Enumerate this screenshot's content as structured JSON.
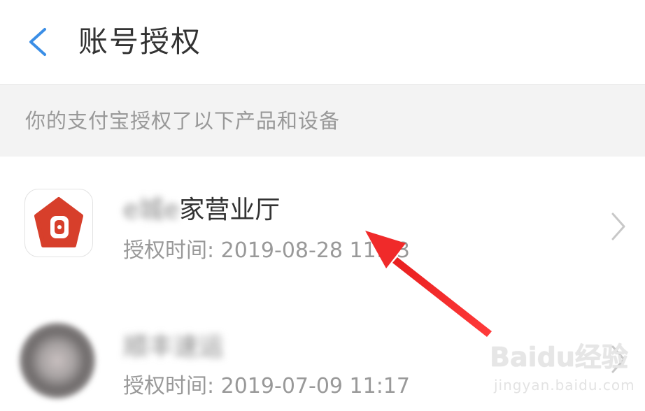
{
  "header": {
    "title": "账号授权",
    "back_icon": "chevron-left-icon",
    "back_color": "#3a8ee6"
  },
  "section": {
    "text": "你的支付宝授权了以下产品和设备"
  },
  "items": [
    {
      "name_blurred": "e城e",
      "name_visible": "家营业厅",
      "time": "授权时间: 2019-08-28 11:43",
      "icon": "house-app-icon",
      "icon_color": "#d73f2b"
    },
    {
      "name_blurred": "顺丰速运",
      "time": "授权时间: 2019-07-09 11:17",
      "icon": "blurred-app-icon"
    }
  ],
  "annotation": {
    "arrow_color": "#f02a2a"
  },
  "watermark": {
    "main": "Baidu经验",
    "sub": "jingyan.baidu.com"
  }
}
